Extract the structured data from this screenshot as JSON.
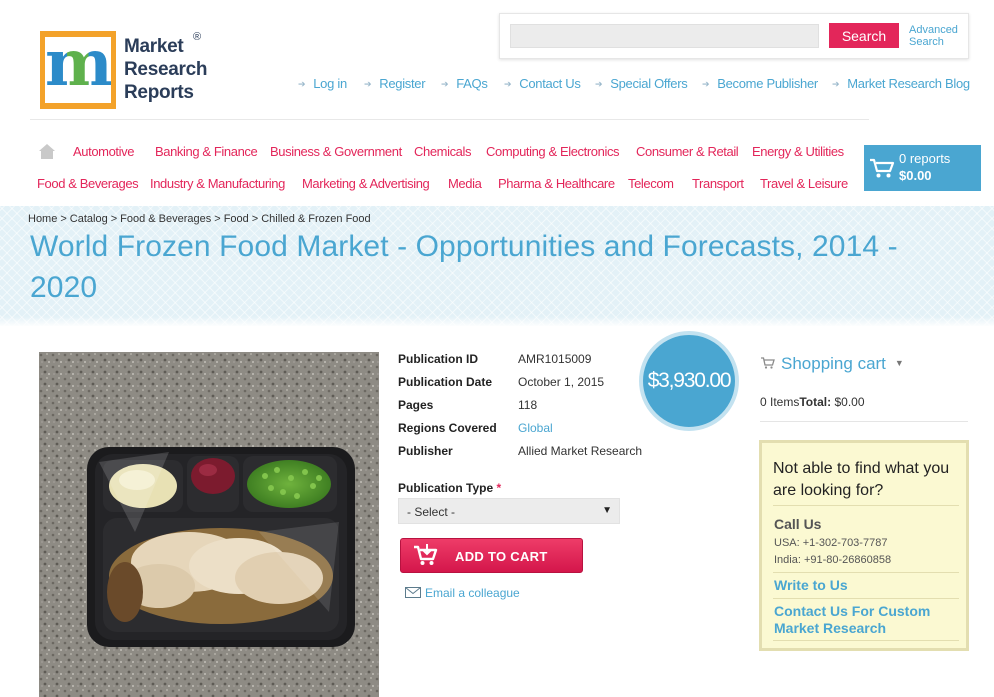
{
  "logo": {
    "lines": [
      "Market",
      "Research",
      "Reports"
    ],
    "registered": "®",
    "letter": "m"
  },
  "search": {
    "button": "Search",
    "advanced": "Advanced Search",
    "placeholder": ""
  },
  "top_links": [
    "Log in",
    "Register",
    "FAQs",
    "Contact Us",
    "Special Offers",
    "Become Publisher",
    "Market Research Blog"
  ],
  "categories_row1": [
    "Automotive",
    "Banking & Finance",
    "Business & Government",
    "Chemicals",
    "Computing & Electronics",
    "Consumer & Retail",
    "Energy & Utilities"
  ],
  "categories_row2": [
    "Food & Beverages",
    "Industry & Manufacturing",
    "Marketing & Advertising",
    "Media",
    "Pharma & Healthcare",
    "Telecom",
    "Transport",
    "Travel & Leisure"
  ],
  "cart": {
    "count": "0 reports",
    "total": "$0.00"
  },
  "breadcrumb": [
    "Home",
    "Catalog",
    "Food & Beverages",
    "Food",
    "Chilled & Frozen Food"
  ],
  "title": "World Frozen Food Market - Opportunities and Forecasts, 2014 - 2020",
  "details": [
    {
      "label": "Publication ID",
      "value": "AMR1015009",
      "link": false
    },
    {
      "label": "Publication Date",
      "value": "October 1, 2015",
      "link": false
    },
    {
      "label": "Pages",
      "value": "118",
      "link": false
    },
    {
      "label": "Regions Covered",
      "value": "Global",
      "link": true
    },
    {
      "label": "Publisher",
      "value": "Allied Market Research",
      "link": false
    }
  ],
  "price": "$3,930.00",
  "publication_type": {
    "label": "Publication Type",
    "required": "*",
    "selected": "- Select -"
  },
  "add_to_cart": "ADD TO CART",
  "email_colleague": "Email a colleague",
  "shopping_cart": {
    "title": "Shopping cart",
    "items": "0 Items",
    "total_label": "Total:",
    "total": "$0.00"
  },
  "help": {
    "title": "Not able to find what you are looking for?",
    "call_us": "Call Us",
    "usa": "USA: +1-302-703-7787",
    "india": "India: +91-80-26860858",
    "write_us": "Write to Us",
    "custom": "Contact Us For Custom Market Research"
  },
  "colors": {
    "accent_blue": "#4aa6d1",
    "accent_pink": "#e3265a",
    "help_bg": "#fbf9d2"
  }
}
